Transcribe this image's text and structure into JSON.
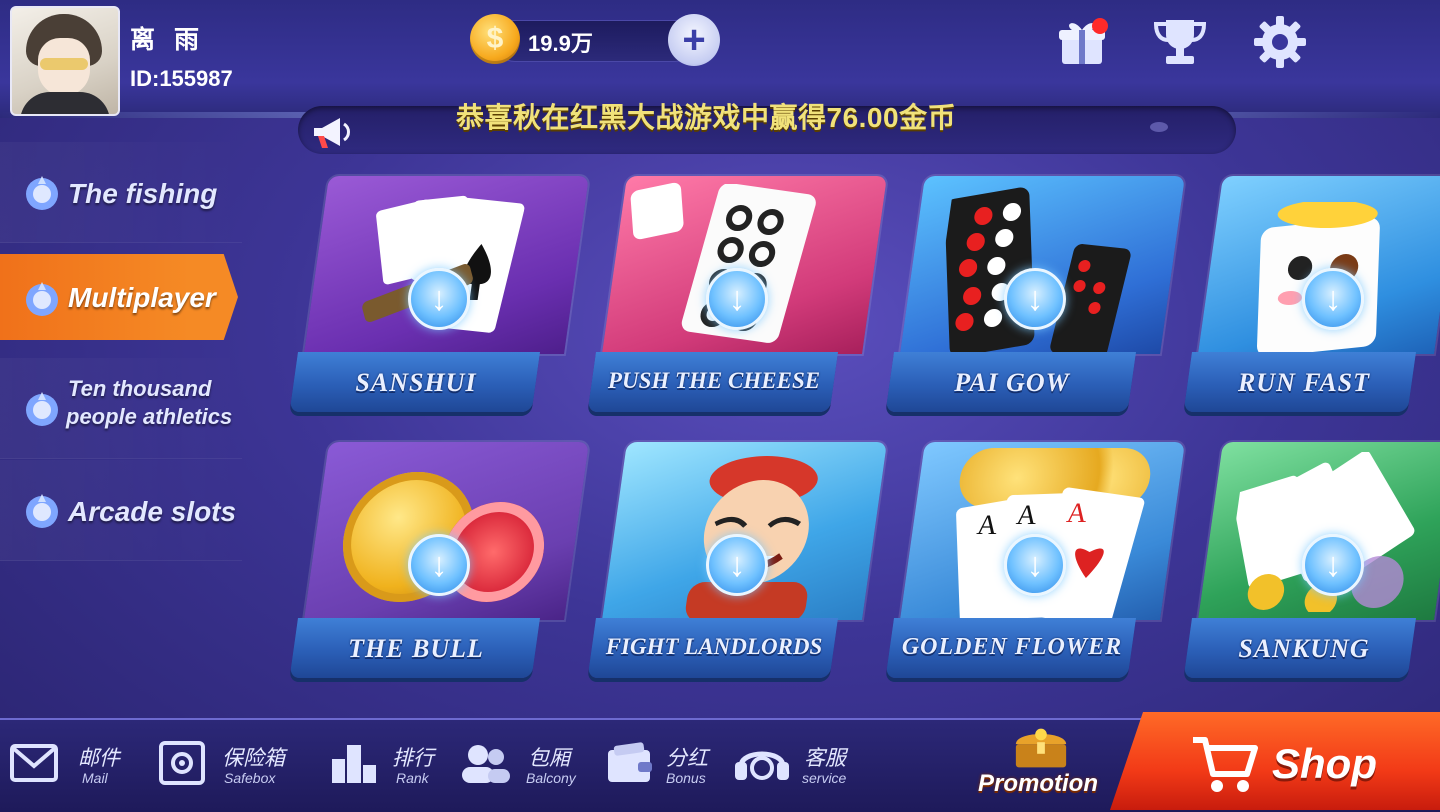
{
  "user": {
    "name": "离 雨",
    "id_text": "ID:155987"
  },
  "coins": {
    "symbol": "$",
    "value": "19.9万",
    "add_symbol": "+"
  },
  "top_icons": {
    "gift": "gift-icon",
    "trophy": "trophy-icon",
    "settings": "gear-icon"
  },
  "broadcast": {
    "message": "恭喜秋在红黑大战游戏中赢得76.00金币",
    "icon": "megaphone-icon"
  },
  "sidebar": {
    "items": [
      {
        "label": "The fishing",
        "active": false
      },
      {
        "label": "Multiplayer",
        "active": true
      },
      {
        "label_line1": "Ten thousand",
        "label_line2": "people athletics",
        "active": false
      },
      {
        "label": "Arcade slots",
        "active": false
      }
    ]
  },
  "games": [
    {
      "title": "SANSHUI",
      "theme": "#7a3fb8"
    },
    {
      "title": "PUSH THE CHEESE",
      "theme": "#d23b7a"
    },
    {
      "title": "PAI GOW",
      "theme": "#2f6fd6"
    },
    {
      "title": "RUN FAST",
      "theme": "#2f8fe0"
    },
    {
      "title": "THE BULL",
      "theme": "#6a3fb0"
    },
    {
      "title": "FIGHT LANDLORDS",
      "theme": "#3fa6e8"
    },
    {
      "title": "GOLDEN  FLOWER",
      "theme": "#3a8ad8"
    },
    {
      "title": "SANKUNG",
      "theme": "#2fa35a"
    }
  ],
  "bottom_nav": [
    {
      "cn": "邮件",
      "en": "Mail",
      "icon": "mail-icon"
    },
    {
      "cn": "保险箱",
      "en": "Safebox",
      "icon": "safe-icon"
    },
    {
      "cn": "排行",
      "en": "Rank",
      "icon": "podium-icon"
    },
    {
      "cn": "包厢",
      "en": "Balcony",
      "icon": "users-icon"
    },
    {
      "cn": "分红",
      "en": "Bonus",
      "icon": "wallet-icon"
    },
    {
      "cn": "客服",
      "en": "service",
      "icon": "headset-icon"
    }
  ],
  "promotion": {
    "label": "Promotion"
  },
  "shop": {
    "label": "Shop"
  }
}
